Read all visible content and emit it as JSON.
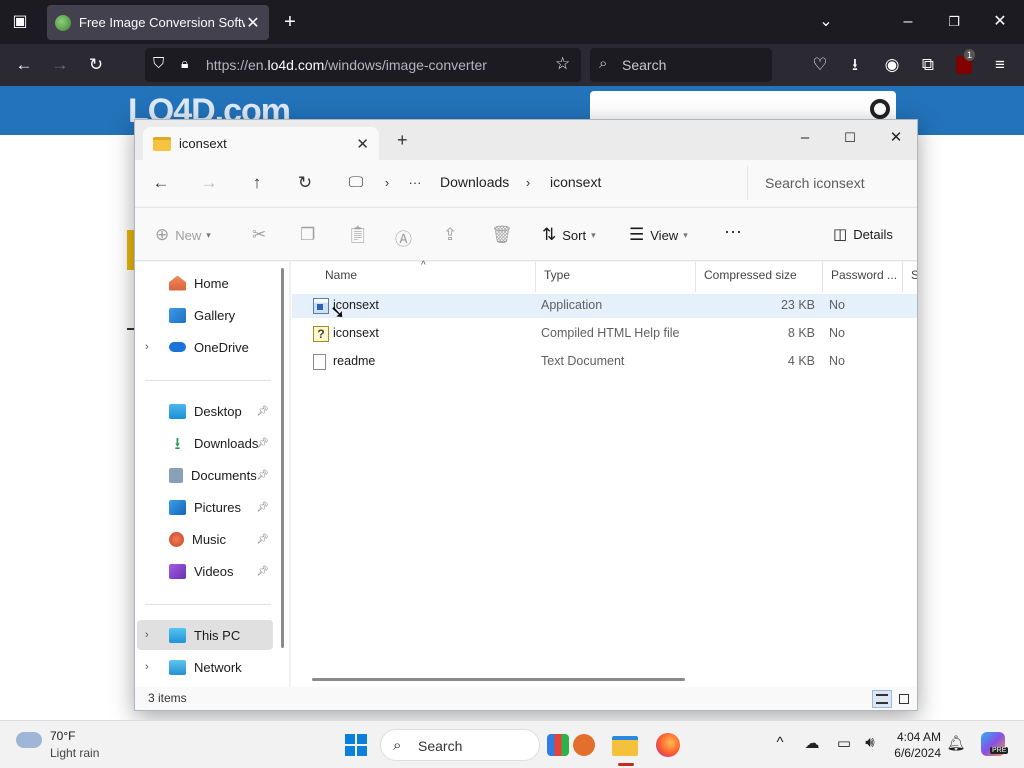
{
  "browser": {
    "tab_title": "Free Image Conversion Software",
    "url_prefix": "https://en.",
    "url_domain": "lo4d.com",
    "url_path": "/windows/image-converter",
    "search_placeholder": "Search",
    "extension_badge": "1"
  },
  "website": {
    "logo_text": "LO4D.com"
  },
  "explorer": {
    "tab_title": "iconsext",
    "breadcrumb": [
      "Downloads",
      "iconsext"
    ],
    "search_placeholder": "Search iconsext",
    "commands": {
      "new": "New",
      "sort": "Sort",
      "view": "View",
      "details": "Details"
    },
    "sidebar": {
      "quick": [
        {
          "label": "Home",
          "icon": "home-icon"
        },
        {
          "label": "Gallery",
          "icon": "gallery-icon"
        },
        {
          "label": "OneDrive",
          "icon": "cloud-icon"
        }
      ],
      "pinned": [
        {
          "label": "Desktop",
          "icon": "desktop-icon"
        },
        {
          "label": "Downloads",
          "icon": "download-icon"
        },
        {
          "label": "Documents",
          "icon": "documents-icon"
        },
        {
          "label": "Pictures",
          "icon": "pictures-icon"
        },
        {
          "label": "Music",
          "icon": "music-icon"
        },
        {
          "label": "Videos",
          "icon": "videos-icon"
        }
      ],
      "devices": [
        {
          "label": "This PC",
          "icon": "computer-icon"
        },
        {
          "label": "Network",
          "icon": "network-icon"
        }
      ]
    },
    "columns": [
      "Name",
      "Type",
      "Compressed size",
      "Password ...",
      "Si"
    ],
    "files": [
      {
        "name": "iconsext",
        "type": "Application",
        "size": "23 KB",
        "password": "No",
        "icon": "application-icon"
      },
      {
        "name": "iconsext",
        "type": "Compiled HTML Help file",
        "size": "8 KB",
        "password": "No",
        "icon": "help-file-icon"
      },
      {
        "name": "readme",
        "type": "Text Document",
        "size": "4 KB",
        "password": "No",
        "icon": "text-file-icon"
      }
    ],
    "status": "3 items"
  },
  "taskbar": {
    "weather_temp": "70°F",
    "weather_desc": "Light rain",
    "search_label": "Search",
    "time": "4:04 AM",
    "date": "6/6/2024",
    "copilot_badge": "PRE"
  }
}
